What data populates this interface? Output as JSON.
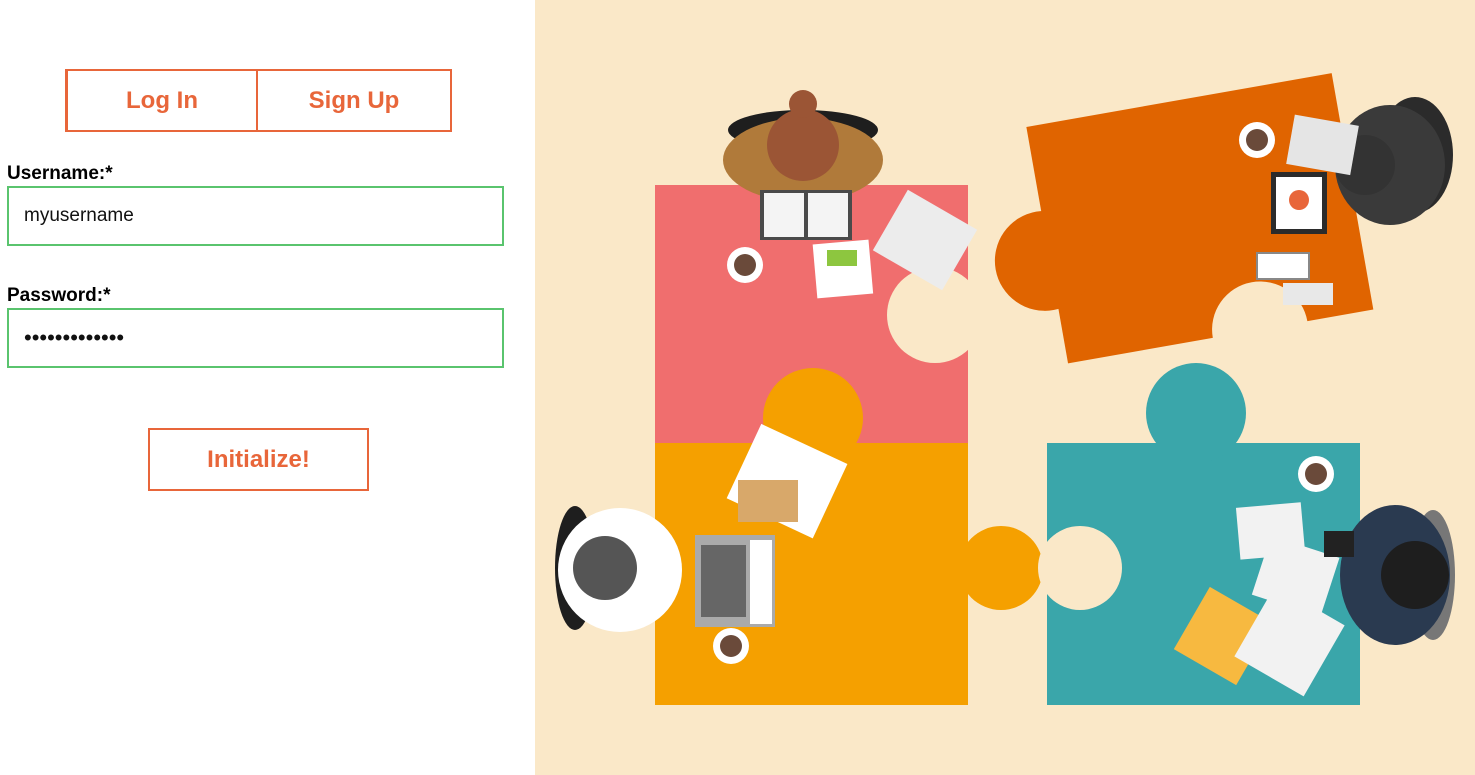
{
  "tabs": {
    "login_label": "Log In",
    "signup_label": "Sign Up"
  },
  "form": {
    "username_label": "Username:*",
    "username_value": "myusername",
    "password_label": "Password:*",
    "password_value": "•••••••••••••",
    "submit_label": "Initialize!"
  },
  "colors": {
    "accent": "#e8663a",
    "field_border": "#5ac46e",
    "illustration_bg": "#fae8c8",
    "puzzle_pink": "#f06e6e",
    "puzzle_orange": "#e06400",
    "puzzle_yellow": "#f5a000",
    "puzzle_teal": "#3aa6aa"
  },
  "illustration": {
    "subject": "team-puzzle-meeting-illustration"
  }
}
